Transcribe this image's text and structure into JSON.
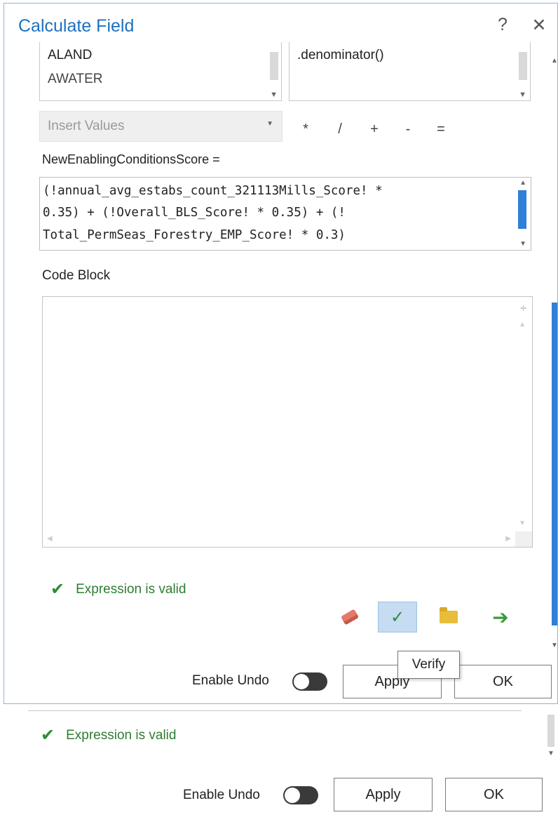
{
  "dialog": {
    "title": "Calculate Field",
    "help_glyph": "?",
    "close_glyph": "✕"
  },
  "fields_list": {
    "items": [
      "ALAND",
      "AWATER"
    ]
  },
  "functions_list": {
    "items": [
      ".denominator()"
    ]
  },
  "insert_values": {
    "placeholder": "Insert Values"
  },
  "operators": [
    "*",
    "/",
    "+",
    "-",
    "="
  ],
  "expression": {
    "label": "NewEnablingConditionsScore =",
    "lines": [
      "(!annual_avg_estabs_count_321113Mills_Score! *",
      "0.35) + (!Overall_BLS_Score! * 0.35) + (!",
      "Total_PermSeas_Forestry_EMP_Score! * 0.3)"
    ]
  },
  "code_block": {
    "label": "Code Block",
    "value": ""
  },
  "status": {
    "text": "Expression is valid",
    "color": "#2e7d32"
  },
  "tools": {
    "clear_icon": "eraser-icon",
    "verify_icon": "checkmark-icon",
    "verify_glyph": "✓",
    "open_icon": "folder-icon",
    "export_icon": "arrow-right-icon",
    "export_glyph": "➔"
  },
  "tooltip": {
    "text": "Verify"
  },
  "footer": {
    "enable_undo_label": "Enable Undo",
    "apply_label": "Apply",
    "ok_label": "OK"
  },
  "lower_panel": {
    "status_text": "Expression is valid",
    "enable_undo_label": "Enable Undo",
    "apply_label": "Apply",
    "ok_label": "OK"
  },
  "colors": {
    "title_blue": "#1c71c1",
    "accent_blue": "#2f7fd7",
    "valid_green": "#2e8b3a"
  }
}
